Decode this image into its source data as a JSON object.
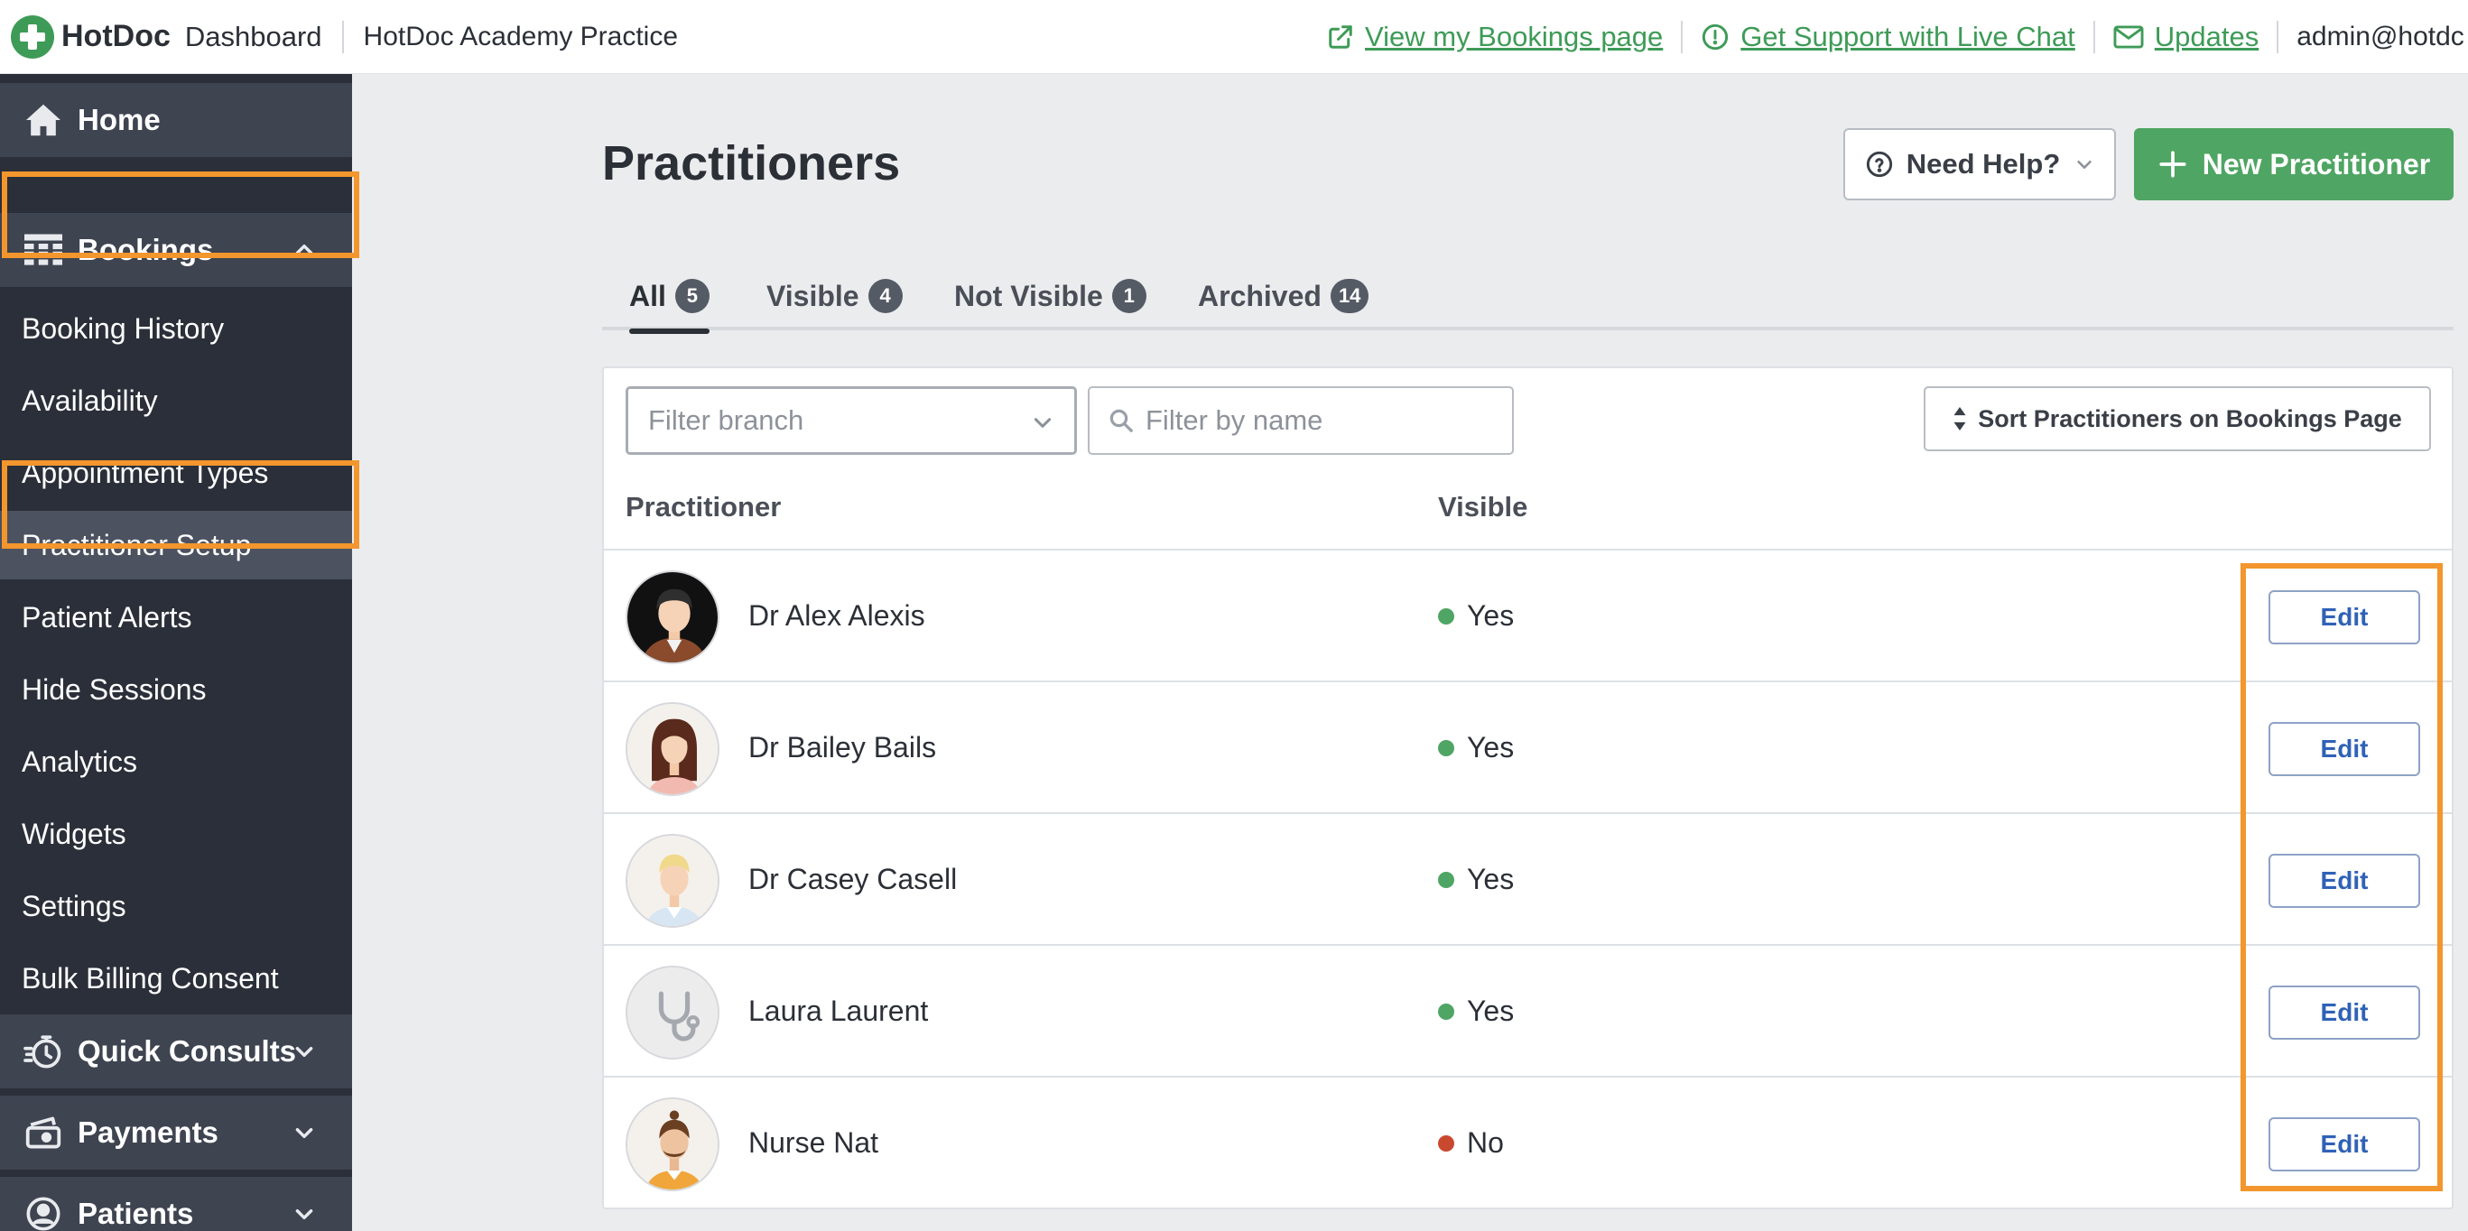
{
  "topbar": {
    "brand": "HotDoc",
    "section": "Dashboard",
    "practice": "HotDoc Academy Practice",
    "links": {
      "bookings_page": "View my Bookings page",
      "support": "Get Support with Live Chat",
      "updates": "Updates"
    },
    "user": "admin@hotdc"
  },
  "sidebar": {
    "home": "Home",
    "bookings": "Bookings",
    "bookings_items": [
      "Booking History",
      "Availability",
      "Appointment Types",
      "Practitioner Setup",
      "Patient Alerts",
      "Hide Sessions",
      "Analytics",
      "Widgets",
      "Settings",
      "Bulk Billing Consent"
    ],
    "quick_consults": "Quick Consults",
    "payments": "Payments",
    "patients": "Patients"
  },
  "page": {
    "title": "Practitioners",
    "need_help": "Need Help?",
    "new_practitioner": "New Practitioner"
  },
  "tabs": [
    {
      "label": "All",
      "count": "5"
    },
    {
      "label": "Visible",
      "count": "4"
    },
    {
      "label": "Not Visible",
      "count": "1"
    },
    {
      "label": "Archived",
      "count": "14"
    }
  ],
  "filters": {
    "branch_placeholder": "Filter branch",
    "name_placeholder": "Filter by name",
    "sort_label": "Sort Practitioners on Bookings Page"
  },
  "table": {
    "headers": {
      "practitioner": "Practitioner",
      "visible": "Visible"
    },
    "edit_label": "Edit",
    "rows": [
      {
        "name": "Dr Alex Alexis",
        "visible": "Yes"
      },
      {
        "name": "Dr Bailey Bails",
        "visible": "Yes"
      },
      {
        "name": "Dr Casey Casell",
        "visible": "Yes"
      },
      {
        "name": "Laura Laurent",
        "visible": "Yes"
      },
      {
        "name": "Nurse Nat",
        "visible": "No"
      }
    ]
  },
  "colors": {
    "brand_green": "#3e9b57",
    "sidebar_bg": "#2a2f39",
    "highlight": "#f2962d",
    "visible_yes": "#4fa563",
    "visible_no": "#c9492f",
    "edit_blue": "#2f62b6"
  }
}
